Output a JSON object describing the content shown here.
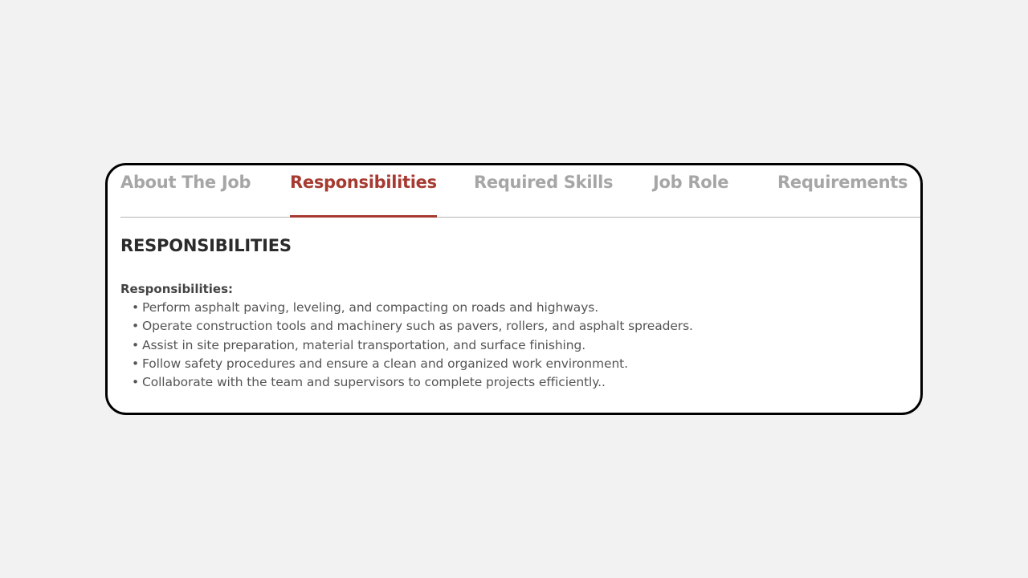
{
  "tabs": [
    {
      "label": "About The Job",
      "active": false
    },
    {
      "label": "Responsibilities",
      "active": true
    },
    {
      "label": "Required Skills",
      "active": false
    },
    {
      "label": "Job Role",
      "active": false
    },
    {
      "label": "Requirements",
      "active": false
    }
  ],
  "content": {
    "title": "RESPONSIBILITIES",
    "subheading": "Responsibilities:",
    "bullet_glyph": "•",
    "items": [
      "Perform asphalt paving, leveling, and compacting on roads and highways.",
      "Operate construction tools and machinery such as pavers, rollers, and asphalt spreaders.",
      "Assist in site preparation, material transportation, and surface finishing.",
      "Follow safety procedures and ensure a clean and organized work environment.",
      "Collaborate with the team and supervisors to complete projects efficiently.."
    ]
  },
  "colors": {
    "active_tab": "#a63a31",
    "inactive_tab": "#a6a6a6",
    "card_border": "#000000",
    "page_background": "#f2f2f2"
  }
}
